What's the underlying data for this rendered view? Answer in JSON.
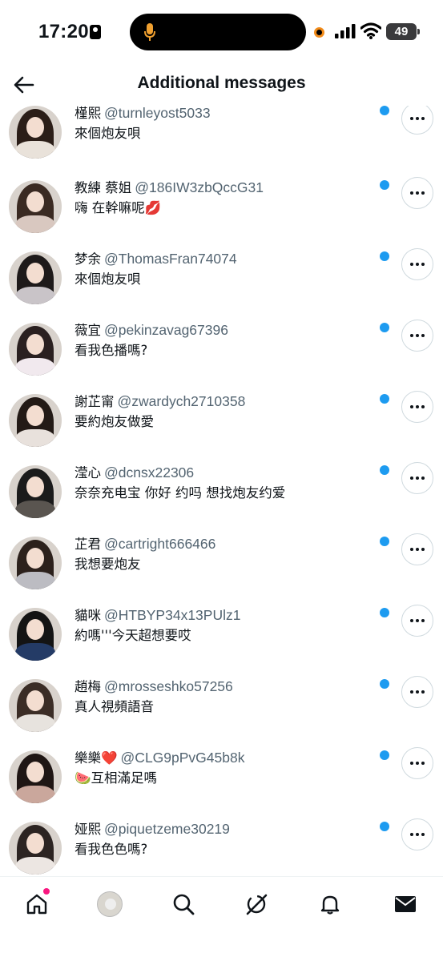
{
  "status_bar": {
    "time": "17:20",
    "battery": "49"
  },
  "header": {
    "title": "Additional messages"
  },
  "conversations": [
    {
      "name": "槿熙",
      "handle": "@turnleyost5033",
      "message": "來個炮友唄",
      "hair": "#2b1e18",
      "top": "#e9e2da"
    },
    {
      "name": "教練 蔡姐",
      "handle": "@186IW3zbQccG31",
      "message": "嗨 在幹嘛呢💋",
      "hair": "#3a2a22",
      "top": "#d9c8c0"
    },
    {
      "name": "梦余",
      "handle": "@ThomasFran74074",
      "message": "來個炮友唄",
      "hair": "#1e1a1a",
      "top": "#c9c4c8"
    },
    {
      "name": "薇宜",
      "handle": "@pekinzavag67396",
      "message": "看我色播嗎?",
      "hair": "#2a2020",
      "top": "#f1e9ee"
    },
    {
      "name": "謝芷甯",
      "handle": "@zwardych2710358",
      "message": "要約炮友做愛",
      "hair": "#231a16",
      "top": "#e8e1dc"
    },
    {
      "name": "滢心",
      "handle": "@dcnsx22306",
      "message": "奈奈充电宝 你好 约吗 想找炮友约爱",
      "hair": "#1b1b1b",
      "top": "#5a5550"
    },
    {
      "name": "芷君",
      "handle": "@cartright666466",
      "message": "我想要炮友",
      "hair": "#2c211c",
      "top": "#bcbcc2"
    },
    {
      "name": "貓咪",
      "handle": "@HTBYP34x13PUlz1",
      "message": "約嗎'''今天超想要哎",
      "hair": "#141414",
      "top": "#243b66"
    },
    {
      "name": "趙梅",
      "handle": "@mrosseshko57256",
      "message": "真人視頻語音",
      "hair": "#3b2d26",
      "top": "#e7e3de"
    },
    {
      "name": "樂樂",
      "heart": "❤️",
      "handle": "@CLG9pPvG45b8k",
      "message": "🍉互相滿足嗎",
      "hair": "#1f1614",
      "top": "#caa79c"
    },
    {
      "name": "娅熙",
      "handle": "@piquetzeme30219",
      "message": "看我色色嗎?",
      "hair": "#2c2422",
      "top": "#ece6e2"
    }
  ],
  "nav": [
    "home-icon",
    "profile-avatar",
    "search-icon",
    "grok-icon",
    "notifications-icon",
    "messages-icon"
  ]
}
